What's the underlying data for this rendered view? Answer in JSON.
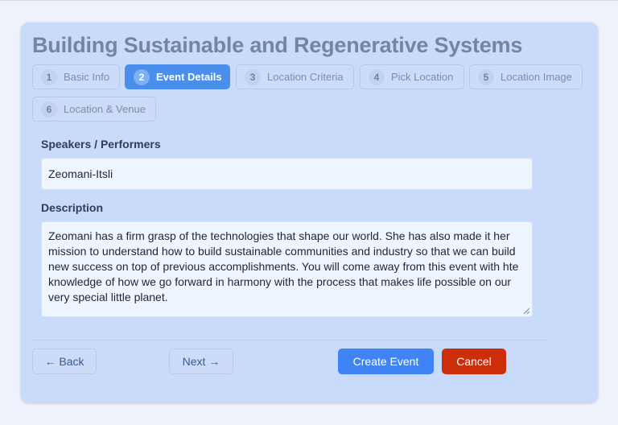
{
  "form": {
    "title": "Building Sustainable and Regenerative Systems",
    "steps": [
      {
        "num": "1",
        "label": "Basic Info"
      },
      {
        "num": "2",
        "label": "Event Details"
      },
      {
        "num": "3",
        "label": "Location Criteria"
      },
      {
        "num": "4",
        "label": "Pick Location"
      },
      {
        "num": "5",
        "label": "Location Image"
      },
      {
        "num": "6",
        "label": "Location & Venue"
      }
    ],
    "active_step": 2,
    "speakers": {
      "label": "Speakers / Performers",
      "value": "Zeomani-Itsli"
    },
    "description": {
      "label": "Description",
      "value": "Zeomani has a firm grasp of the technologies that shape our world. She has also made it her mission to understand how to build sustainable communities and industry so that we can build new success on top of previous accomplishments. You will come away from this event with hte knowledge of how we go forward in harmony with the process that makes life possible on our very special little planet."
    },
    "buttons": {
      "back": "← Back",
      "next": "Next →",
      "create": "Create Event",
      "cancel": "Cancel"
    }
  },
  "colors": {
    "card_bg": "#c9dbfb",
    "active_step": "#4a8fec",
    "primary": "#3f84f5",
    "danger": "#cc2e0a"
  }
}
